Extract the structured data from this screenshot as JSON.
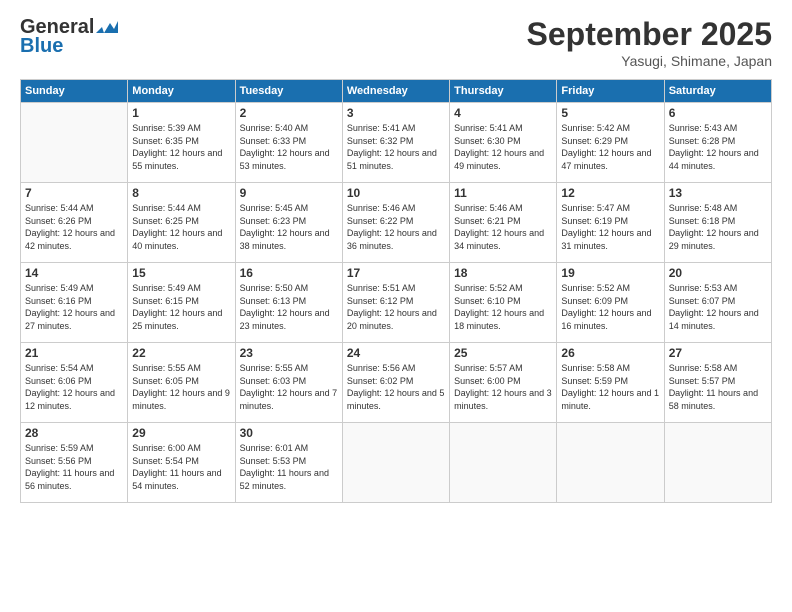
{
  "header": {
    "logo_line1": "General",
    "logo_line2": "Blue",
    "month": "September 2025",
    "location": "Yasugi, Shimane, Japan"
  },
  "days_of_week": [
    "Sunday",
    "Monday",
    "Tuesday",
    "Wednesday",
    "Thursday",
    "Friday",
    "Saturday"
  ],
  "weeks": [
    [
      {
        "day": "",
        "sunrise": "",
        "sunset": "",
        "daylight": ""
      },
      {
        "day": "1",
        "sunrise": "Sunrise: 5:39 AM",
        "sunset": "Sunset: 6:35 PM",
        "daylight": "Daylight: 12 hours and 55 minutes."
      },
      {
        "day": "2",
        "sunrise": "Sunrise: 5:40 AM",
        "sunset": "Sunset: 6:33 PM",
        "daylight": "Daylight: 12 hours and 53 minutes."
      },
      {
        "day": "3",
        "sunrise": "Sunrise: 5:41 AM",
        "sunset": "Sunset: 6:32 PM",
        "daylight": "Daylight: 12 hours and 51 minutes."
      },
      {
        "day": "4",
        "sunrise": "Sunrise: 5:41 AM",
        "sunset": "Sunset: 6:30 PM",
        "daylight": "Daylight: 12 hours and 49 minutes."
      },
      {
        "day": "5",
        "sunrise": "Sunrise: 5:42 AM",
        "sunset": "Sunset: 6:29 PM",
        "daylight": "Daylight: 12 hours and 47 minutes."
      },
      {
        "day": "6",
        "sunrise": "Sunrise: 5:43 AM",
        "sunset": "Sunset: 6:28 PM",
        "daylight": "Daylight: 12 hours and 44 minutes."
      }
    ],
    [
      {
        "day": "7",
        "sunrise": "Sunrise: 5:44 AM",
        "sunset": "Sunset: 6:26 PM",
        "daylight": "Daylight: 12 hours and 42 minutes."
      },
      {
        "day": "8",
        "sunrise": "Sunrise: 5:44 AM",
        "sunset": "Sunset: 6:25 PM",
        "daylight": "Daylight: 12 hours and 40 minutes."
      },
      {
        "day": "9",
        "sunrise": "Sunrise: 5:45 AM",
        "sunset": "Sunset: 6:23 PM",
        "daylight": "Daylight: 12 hours and 38 minutes."
      },
      {
        "day": "10",
        "sunrise": "Sunrise: 5:46 AM",
        "sunset": "Sunset: 6:22 PM",
        "daylight": "Daylight: 12 hours and 36 minutes."
      },
      {
        "day": "11",
        "sunrise": "Sunrise: 5:46 AM",
        "sunset": "Sunset: 6:21 PM",
        "daylight": "Daylight: 12 hours and 34 minutes."
      },
      {
        "day": "12",
        "sunrise": "Sunrise: 5:47 AM",
        "sunset": "Sunset: 6:19 PM",
        "daylight": "Daylight: 12 hours and 31 minutes."
      },
      {
        "day": "13",
        "sunrise": "Sunrise: 5:48 AM",
        "sunset": "Sunset: 6:18 PM",
        "daylight": "Daylight: 12 hours and 29 minutes."
      }
    ],
    [
      {
        "day": "14",
        "sunrise": "Sunrise: 5:49 AM",
        "sunset": "Sunset: 6:16 PM",
        "daylight": "Daylight: 12 hours and 27 minutes."
      },
      {
        "day": "15",
        "sunrise": "Sunrise: 5:49 AM",
        "sunset": "Sunset: 6:15 PM",
        "daylight": "Daylight: 12 hours and 25 minutes."
      },
      {
        "day": "16",
        "sunrise": "Sunrise: 5:50 AM",
        "sunset": "Sunset: 6:13 PM",
        "daylight": "Daylight: 12 hours and 23 minutes."
      },
      {
        "day": "17",
        "sunrise": "Sunrise: 5:51 AM",
        "sunset": "Sunset: 6:12 PM",
        "daylight": "Daylight: 12 hours and 20 minutes."
      },
      {
        "day": "18",
        "sunrise": "Sunrise: 5:52 AM",
        "sunset": "Sunset: 6:10 PM",
        "daylight": "Daylight: 12 hours and 18 minutes."
      },
      {
        "day": "19",
        "sunrise": "Sunrise: 5:52 AM",
        "sunset": "Sunset: 6:09 PM",
        "daylight": "Daylight: 12 hours and 16 minutes."
      },
      {
        "day": "20",
        "sunrise": "Sunrise: 5:53 AM",
        "sunset": "Sunset: 6:07 PM",
        "daylight": "Daylight: 12 hours and 14 minutes."
      }
    ],
    [
      {
        "day": "21",
        "sunrise": "Sunrise: 5:54 AM",
        "sunset": "Sunset: 6:06 PM",
        "daylight": "Daylight: 12 hours and 12 minutes."
      },
      {
        "day": "22",
        "sunrise": "Sunrise: 5:55 AM",
        "sunset": "Sunset: 6:05 PM",
        "daylight": "Daylight: 12 hours and 9 minutes."
      },
      {
        "day": "23",
        "sunrise": "Sunrise: 5:55 AM",
        "sunset": "Sunset: 6:03 PM",
        "daylight": "Daylight: 12 hours and 7 minutes."
      },
      {
        "day": "24",
        "sunrise": "Sunrise: 5:56 AM",
        "sunset": "Sunset: 6:02 PM",
        "daylight": "Daylight: 12 hours and 5 minutes."
      },
      {
        "day": "25",
        "sunrise": "Sunrise: 5:57 AM",
        "sunset": "Sunset: 6:00 PM",
        "daylight": "Daylight: 12 hours and 3 minutes."
      },
      {
        "day": "26",
        "sunrise": "Sunrise: 5:58 AM",
        "sunset": "Sunset: 5:59 PM",
        "daylight": "Daylight: 12 hours and 1 minute."
      },
      {
        "day": "27",
        "sunrise": "Sunrise: 5:58 AM",
        "sunset": "Sunset: 5:57 PM",
        "daylight": "Daylight: 11 hours and 58 minutes."
      }
    ],
    [
      {
        "day": "28",
        "sunrise": "Sunrise: 5:59 AM",
        "sunset": "Sunset: 5:56 PM",
        "daylight": "Daylight: 11 hours and 56 minutes."
      },
      {
        "day": "29",
        "sunrise": "Sunrise: 6:00 AM",
        "sunset": "Sunset: 5:54 PM",
        "daylight": "Daylight: 11 hours and 54 minutes."
      },
      {
        "day": "30",
        "sunrise": "Sunrise: 6:01 AM",
        "sunset": "Sunset: 5:53 PM",
        "daylight": "Daylight: 11 hours and 52 minutes."
      },
      {
        "day": "",
        "sunrise": "",
        "sunset": "",
        "daylight": ""
      },
      {
        "day": "",
        "sunrise": "",
        "sunset": "",
        "daylight": ""
      },
      {
        "day": "",
        "sunrise": "",
        "sunset": "",
        "daylight": ""
      },
      {
        "day": "",
        "sunrise": "",
        "sunset": "",
        "daylight": ""
      }
    ]
  ]
}
